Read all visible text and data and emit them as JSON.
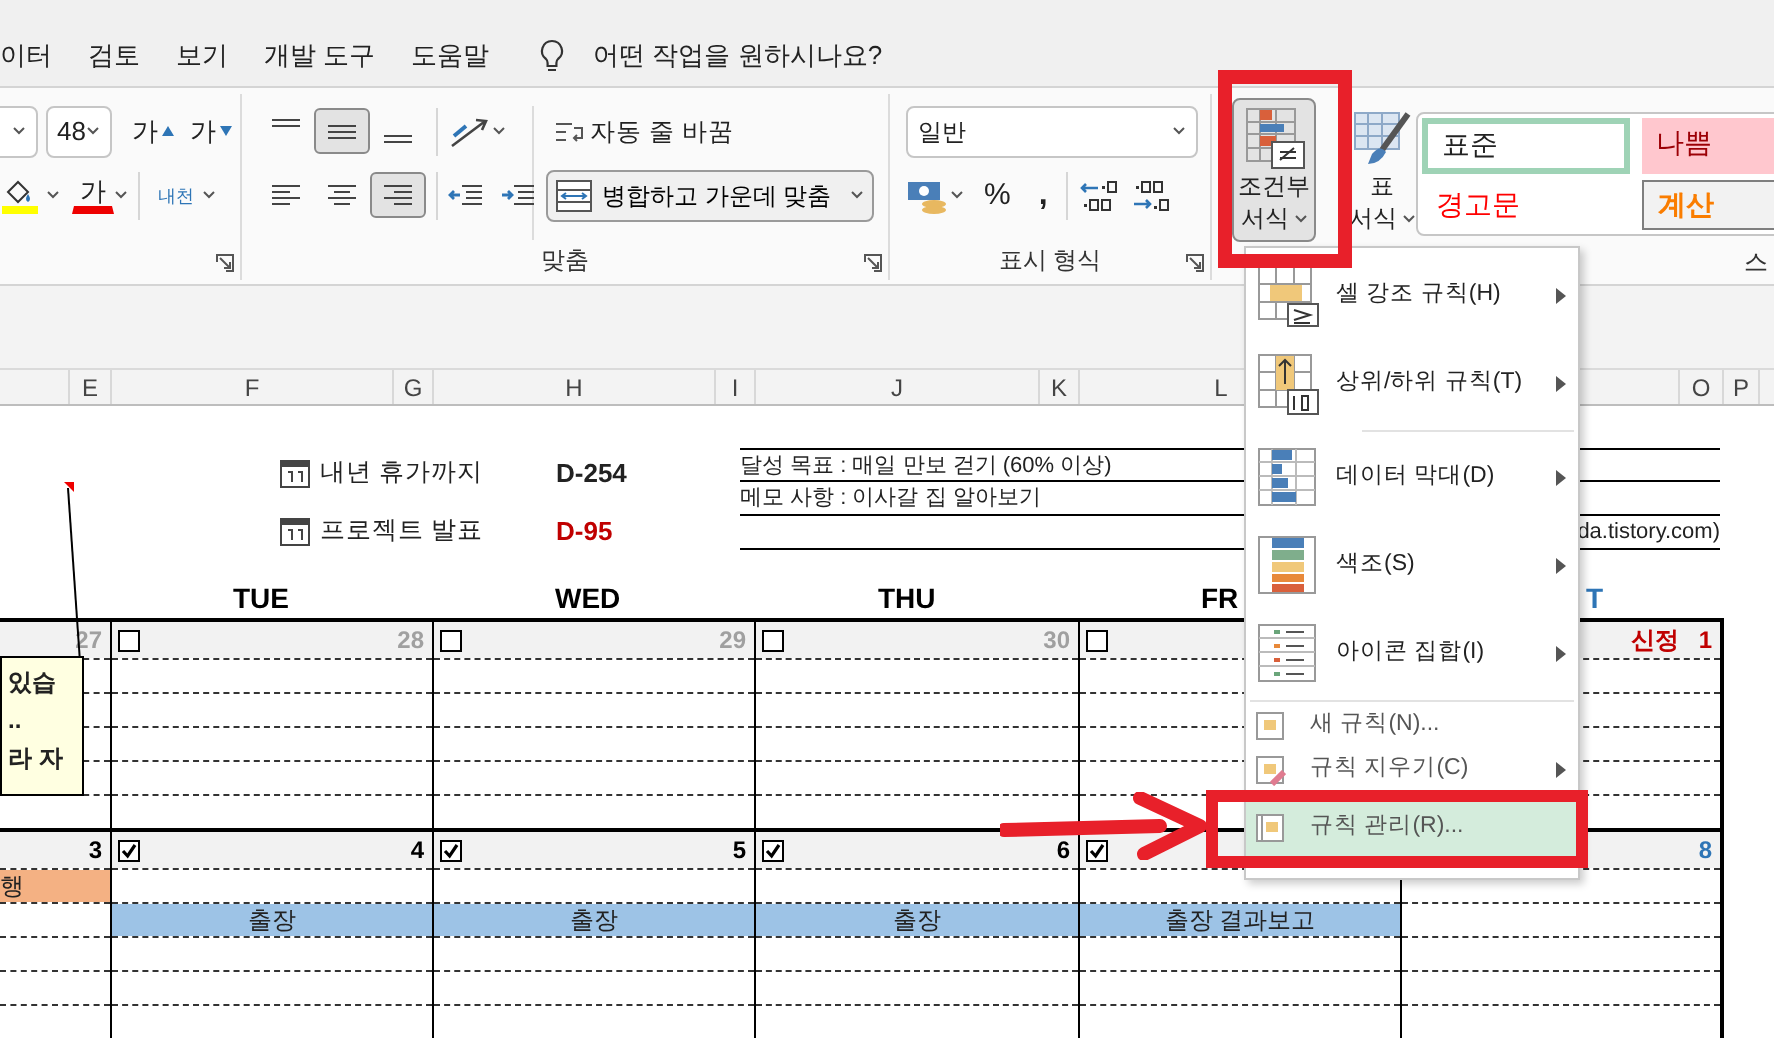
{
  "menu_tabs": [
    "이터",
    "검토",
    "보기",
    "개발 도구",
    "도움말"
  ],
  "tell_me": {
    "placeholder": "어떤 작업을 원하시나요?"
  },
  "ribbon": {
    "font": {
      "size": "48",
      "grow": "가",
      "shrink": "가",
      "font_color_label": "가",
      "phonetic": "내천"
    },
    "alignment": {
      "vertical": [
        {
          "kind": "top",
          "selected": false
        },
        {
          "kind": "middle",
          "selected": true
        },
        {
          "kind": "bottom",
          "selected": false
        }
      ],
      "horizontal": [
        {
          "kind": "left",
          "selected": false
        },
        {
          "kind": "center",
          "selected": false
        },
        {
          "kind": "right",
          "selected": true
        }
      ],
      "wrap_text": "자동 줄 바꿈",
      "merge": "병합하고 가운데 맞춤",
      "label": "맞춤"
    },
    "number": {
      "format": "일반",
      "percent": "%",
      "comma": ",",
      "label": "표시 형식"
    },
    "conditional_formatting": {
      "lines": [
        "조건부",
        "서식"
      ],
      "expanded": true
    },
    "format_as_table": {
      "lines": [
        "표",
        "서식"
      ]
    },
    "styles": {
      "cells": [
        {
          "label": "표준",
          "kind": "normal"
        },
        {
          "label": "나쁨",
          "kind": "bad"
        },
        {
          "label": "경고문",
          "kind": "warning"
        },
        {
          "label": "계산",
          "kind": "calculation"
        }
      ],
      "label": "스"
    }
  },
  "conditional_menu": [
    {
      "label": "셀 강조 규칙(H)",
      "kind": "highlight",
      "submenu": true,
      "selected": false
    },
    {
      "label": "상위/하위 규칙(T)",
      "kind": "topbottom",
      "submenu": true,
      "selected": false
    },
    {
      "label": "데이터 막대(D)",
      "kind": "databar",
      "submenu": true,
      "selected": false
    },
    {
      "label": "색조(S)",
      "kind": "colorscale",
      "submenu": true,
      "selected": false
    },
    {
      "label": "아이콘 집합(I)",
      "kind": "iconset",
      "submenu": true,
      "selected": false
    },
    {
      "label": "새 규칙(N)...",
      "kind": "new",
      "submenu": false,
      "selected": false
    },
    {
      "label": "규칙 지우기(C)",
      "kind": "clear",
      "submenu": true,
      "selected": false
    },
    {
      "label": "규칙 관리(R)...",
      "kind": "manage",
      "submenu": false,
      "selected": true
    }
  ],
  "sheet": {
    "column_headers": [
      "E",
      "F",
      "G",
      "H",
      "I",
      "J",
      "K",
      "L",
      "O",
      "P"
    ],
    "comment": {
      "lines": [
        "있습",
        "..",
        "라 자"
      ]
    },
    "countdowns": [
      {
        "label": "내년 휴가까지",
        "value": "D-254",
        "urgent": false
      },
      {
        "label": "프로젝트 발표",
        "value": "D-95",
        "urgent": true
      }
    ],
    "notes": [
      {
        "text": "달성 목표 : 매일 만보 걷기 (60% 이상)",
        "kind": "goal"
      },
      {
        "text": "메모 사항 : 이사갈 집 알아보기",
        "kind": "memo"
      },
      {
        "text": "da.tistory.com)",
        "kind": "source"
      }
    ],
    "calendar": {
      "day_headers": [
        {
          "label": "TUE",
          "kind": "weekday"
        },
        {
          "label": "WED",
          "kind": "weekday"
        },
        {
          "label": "THU",
          "kind": "weekday"
        },
        {
          "label": "FR",
          "kind": "weekday"
        },
        {
          "label": "T",
          "kind": "saturday"
        }
      ],
      "weeks": [
        {
          "days": [
            {
              "number": "27",
              "kind": "other"
            },
            {
              "number": "28",
              "kind": "other",
              "checked": false
            },
            {
              "number": "29",
              "kind": "other",
              "checked": false
            },
            {
              "number": "30",
              "kind": "other",
              "checked": false
            },
            {
              "kind": "weekday",
              "checked": false
            },
            {
              "number": "1",
              "holiday": "신정",
              "kind": "holiday"
            }
          ]
        },
        {
          "days": [
            {
              "number": "3",
              "kind": "weekday",
              "events": [
                {
                  "text": "행",
                  "color": "#f4b183",
                  "kind": "personal"
                }
              ]
            },
            {
              "number": "4",
              "kind": "weekday",
              "checked": true,
              "events": [
                {
                  "text": "출장",
                  "color": "#9dc3e6",
                  "kind": "trip"
                }
              ]
            },
            {
              "number": "5",
              "kind": "weekday",
              "checked": true,
              "events": [
                {
                  "text": "출장",
                  "color": "#9dc3e6",
                  "kind": "trip"
                }
              ]
            },
            {
              "number": "6",
              "kind": "weekday",
              "checked": true,
              "events": [
                {
                  "text": "출장",
                  "color": "#9dc3e6",
                  "kind": "trip"
                }
              ]
            },
            {
              "kind": "weekday",
              "checked": true,
              "events": [
                {
                  "text": "출장 결과보고",
                  "color": "#9dc3e6",
                  "kind": "trip"
                }
              ]
            },
            {
              "number": "8",
              "kind": "saturday"
            }
          ]
        }
      ]
    }
  }
}
